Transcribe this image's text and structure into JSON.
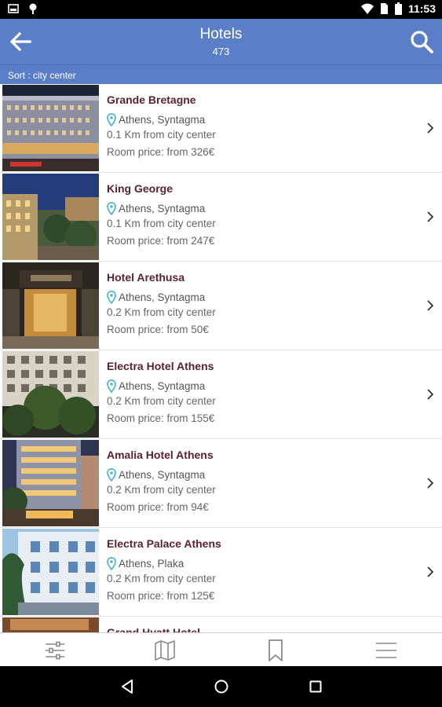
{
  "status_bar": {
    "time": "11:53",
    "icons": [
      "image-notification-icon",
      "pin-notification-icon",
      "wifi-icon",
      "sim-icon",
      "battery-icon"
    ]
  },
  "header": {
    "title": "Hotels",
    "count": "473",
    "color": "#5b7ec8"
  },
  "sort": {
    "label": "Sort : city center"
  },
  "hotels": [
    {
      "name": "Grande Bretagne",
      "location": "Athens, Syntagma",
      "distance": "0.1 Km from city center",
      "price": "Room price: from 326€"
    },
    {
      "name": "King George",
      "location": "Athens, Syntagma",
      "distance": "0.1 Km from city center",
      "price": "Room price: from 247€"
    },
    {
      "name": "Hotel Arethusa",
      "location": "Athens, Syntagma",
      "distance": "0.2 Km from city center",
      "price": "Room price: from 50€"
    },
    {
      "name": "Electra Hotel Athens",
      "location": "Athens, Syntagma",
      "distance": "0.2 Km from city center",
      "price": "Room price: from 155€"
    },
    {
      "name": "Amalia Hotel Athens",
      "location": "Athens, Syntagma",
      "distance": "0.2 Km from city center",
      "price": "Room price: from 94€"
    },
    {
      "name": "Electra Palace Athens",
      "location": "Athens, Plaka",
      "distance": "0.2 Km from city center",
      "price": "Room price: from 125€"
    },
    {
      "name": "Grand Hyatt Hotel",
      "location": "",
      "distance": "",
      "price": ""
    }
  ],
  "bottom_tabs": [
    "filter-icon",
    "map-icon",
    "bookmark-icon",
    "menu-icon"
  ],
  "system_nav": [
    "back-triangle-icon",
    "home-circle-icon",
    "recents-square-icon"
  ],
  "colors": {
    "hotel_name": "#5a2230",
    "pin": "#4fb8c8"
  }
}
